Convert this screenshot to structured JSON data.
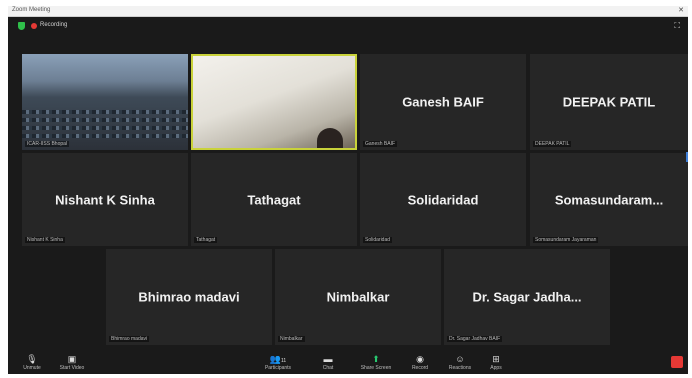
{
  "window": {
    "app_title": "Zoom Meeting",
    "recording_label": "Recording",
    "view_label": "⛶"
  },
  "participants": [
    {
      "display_name": "",
      "tag": "ICAR-IISS Bhopal"
    },
    {
      "display_name": "",
      "tag": ""
    },
    {
      "display_name": "Ganesh BAIF",
      "tag": "Ganesh BAIF"
    },
    {
      "display_name": "DEEPAK PATIL",
      "tag": "DEEPAK PATIL"
    },
    {
      "display_name": "Nishant K Sinha",
      "tag": "Nishant K Sinha"
    },
    {
      "display_name": "Tathagat",
      "tag": "Tathagat"
    },
    {
      "display_name": "Solidaridad",
      "tag": "Solidaridad"
    },
    {
      "display_name": "Somasundaram...",
      "tag": "Somasundaram Jayaraman"
    },
    {
      "display_name": "Bhimrao madavi",
      "tag": "Bhimrao madavi"
    },
    {
      "display_name": "Nimbalkar",
      "tag": "Nimbalkar"
    },
    {
      "display_name": "Dr. Sagar Jadha...",
      "tag": "Dr. Sagar Jadhav BAIF"
    }
  ],
  "toolbar": {
    "unmute": "Unmute",
    "start_video": "Start Video",
    "participants": "Participants",
    "chat": "Chat",
    "share_screen": "Share Screen",
    "record": "Record",
    "reactions": "Reactions",
    "apps": "Apps",
    "participants_count": "11"
  },
  "colors": {
    "active_speaker": "#c9d23a",
    "share": "#28c76f",
    "end": "#e53935"
  }
}
